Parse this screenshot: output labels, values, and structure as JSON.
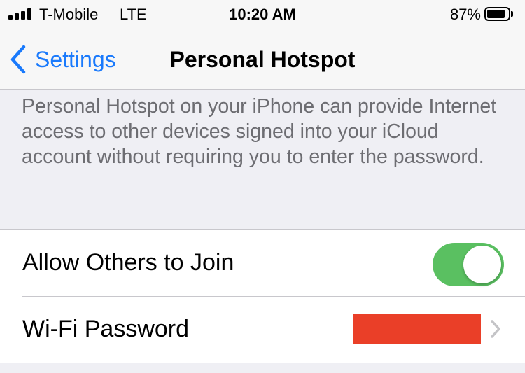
{
  "status_bar": {
    "carrier": "T-Mobile",
    "network": "LTE",
    "time": "10:20 AM",
    "battery_percent": "87%",
    "battery_level": 0.87,
    "signal_bars": 4
  },
  "nav": {
    "back_label": "Settings",
    "title": "Personal Hotspot",
    "back_icon": "chevron-left-icon",
    "tint_color": "#1a7afc"
  },
  "description": "Personal Hotspot on your iPhone can provide Internet access to other devices signed into your iCloud account without requiring you to enter the password.",
  "settings": {
    "allow_others": {
      "label": "Allow Others to Join",
      "enabled": true,
      "toggle_color": "#5ac061"
    },
    "wifi_password": {
      "label": "Wi-Fi Password",
      "value_redacted": true,
      "redaction_color": "#ea3f28",
      "disclosure_icon": "chevron-right-icon"
    }
  }
}
